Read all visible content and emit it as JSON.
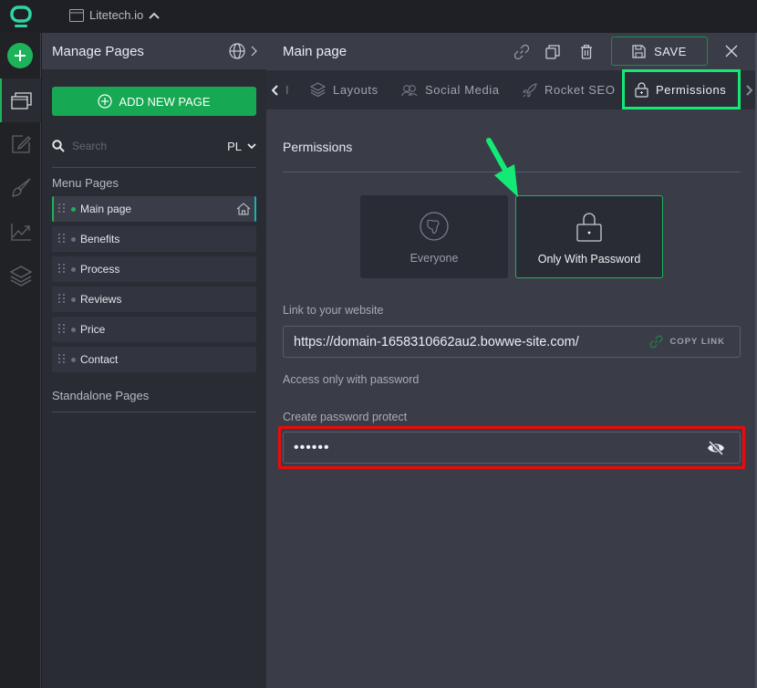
{
  "app": {
    "site_name": "Litetech.io",
    "logo_icon": "bowwe-logo-icon",
    "site_icon": "window-icon",
    "site_chevron": "chevron-up-icon"
  },
  "rail": {
    "add_icon": "plus-icon",
    "items": [
      {
        "name": "pages",
        "icon": "pages-icon",
        "active": true
      },
      {
        "name": "edit",
        "icon": "edit-icon",
        "active": false
      },
      {
        "name": "design",
        "icon": "brush-icon",
        "active": false
      },
      {
        "name": "analytics",
        "icon": "chart-icon",
        "active": false
      },
      {
        "name": "layers",
        "icon": "layers-icon",
        "active": false
      }
    ]
  },
  "pages_panel": {
    "title": "Manage Pages",
    "globe_icon": "globe-icon",
    "chevron_icon": "chevron-right-icon",
    "add_button": "ADD NEW PAGE",
    "search_placeholder": "Search",
    "language": "PL",
    "menu_section": "Menu Pages",
    "pages": [
      {
        "name": "Main page",
        "active": true,
        "home": true
      },
      {
        "name": "Benefits",
        "active": false,
        "home": false
      },
      {
        "name": "Process",
        "active": false,
        "home": false
      },
      {
        "name": "Reviews",
        "active": false,
        "home": false
      },
      {
        "name": "Price",
        "active": false,
        "home": false
      },
      {
        "name": "Contact",
        "active": false,
        "home": false
      }
    ],
    "standalone_section": "Standalone Pages"
  },
  "main": {
    "title": "Main page",
    "save_label": "SAVE",
    "header_icons": [
      "link-icon",
      "duplicate-icon",
      "trash-icon",
      "save-icon",
      "close-icon"
    ],
    "tabs": [
      {
        "label": "I",
        "icon": "chevron-left-icon",
        "active": false
      },
      {
        "label": "Layouts",
        "icon": "layers-icon",
        "active": false
      },
      {
        "label": "Social Media",
        "icon": "users-icon",
        "active": false
      },
      {
        "label": "Rocket SEO",
        "icon": "rocket-icon",
        "active": false
      },
      {
        "label": "Permissions",
        "icon": "lock-icon",
        "active": true
      }
    ],
    "tab_next_icon": "chevron-right-icon",
    "permissions": {
      "heading": "Permissions",
      "options": [
        {
          "label": "Everyone",
          "icon": "globe-icon",
          "selected": false
        },
        {
          "label": "Only With Password",
          "icon": "lock-icon",
          "selected": true
        }
      ],
      "link_label": "Link to your website",
      "link_value": "https://domain-1658310662au2.bowwe-site.com/",
      "copy_label": "COPY LINK",
      "access_text": "Access only with password",
      "password_label": "Create password protect",
      "password_value": "••••••",
      "password_toggle_icon": "eye-off-icon"
    }
  },
  "annotations": {
    "tab_highlight_color": "#12ea75",
    "password_highlight_color": "#ee0a0a",
    "arrow_color": "#12ea75"
  },
  "colors": {
    "accent": "#1db35a",
    "panel": "#2a2c34",
    "main_bg": "#3a3d48"
  }
}
